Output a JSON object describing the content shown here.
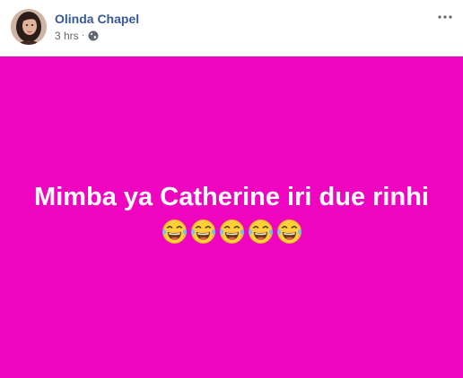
{
  "post": {
    "author": "Olinda Chapel",
    "time": "3 hrs",
    "separator": "·",
    "privacy_icon": "globe-icon",
    "menu_icon": "more-horizontal-icon",
    "status_text": "Mimba ya Catherine iri due rinhi",
    "emoji_icon": "tears-of-joy-emoji-icon",
    "emoji_count": 5,
    "background_color": "#ef04bf",
    "name_color": "#385898"
  }
}
